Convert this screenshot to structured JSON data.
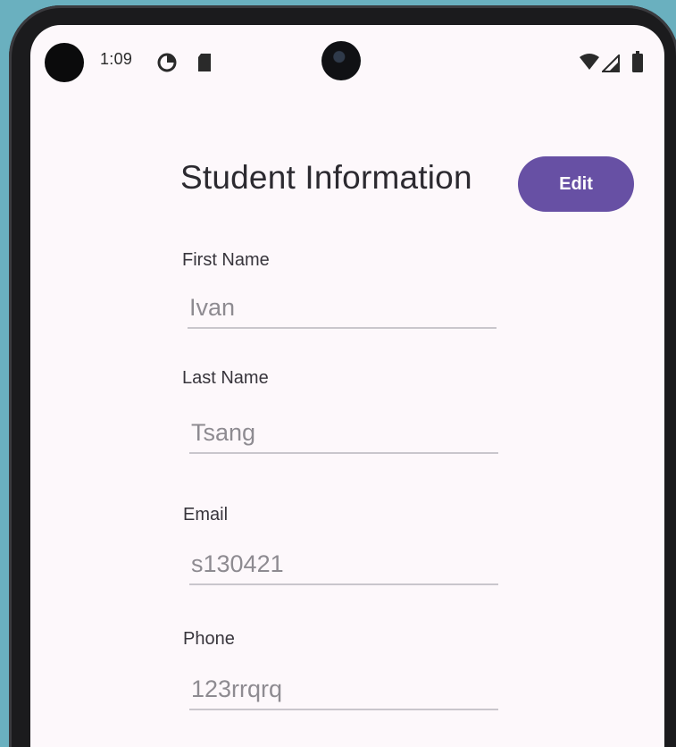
{
  "status_bar": {
    "time": "1:09",
    "icons": [
      "data-saver-icon",
      "sim-card-icon",
      "wifi-icon",
      "signal-icon",
      "battery-icon"
    ]
  },
  "screen": {
    "title": "Student Information",
    "edit_label": "Edit"
  },
  "form": {
    "first_name": {
      "label": "First Name",
      "value": "Ivan"
    },
    "last_name": {
      "label": "Last Name",
      "value": "Tsang"
    },
    "email": {
      "label": "Email",
      "value": "s130421"
    },
    "phone": {
      "label": "Phone",
      "value": "123rrqrq"
    }
  },
  "colors": {
    "accent": "#6750a4",
    "background": "#fdf8fb",
    "outer": "#6ab0bf"
  }
}
